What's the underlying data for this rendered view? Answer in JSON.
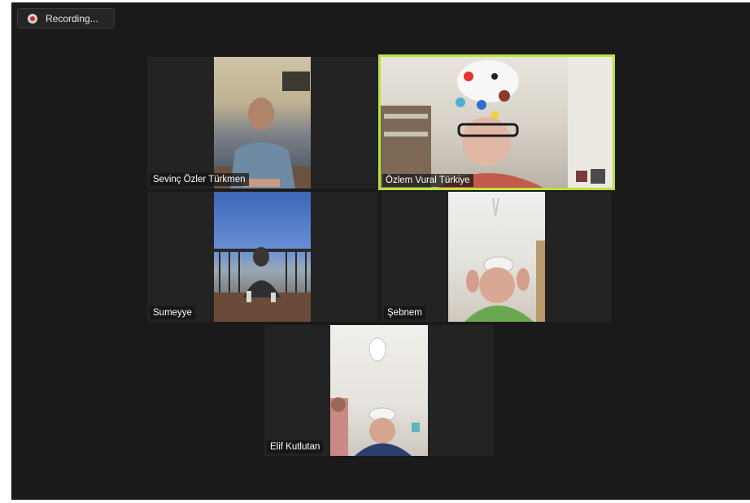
{
  "recording": {
    "icon": "record-icon",
    "label": "Recording...",
    "indicator_color": "#e02828"
  },
  "gallery": {
    "active_speaker_border": "#b9e23f",
    "participants": [
      {
        "name": "Sevinç Özler Türkmen",
        "active": false
      },
      {
        "name": "Özlem Vural Türkiye",
        "active": true
      },
      {
        "name": "Sumeyye",
        "active": false
      },
      {
        "name": "Şebnem",
        "active": false
      },
      {
        "name": "Elif Kutlutan",
        "active": false
      }
    ]
  }
}
